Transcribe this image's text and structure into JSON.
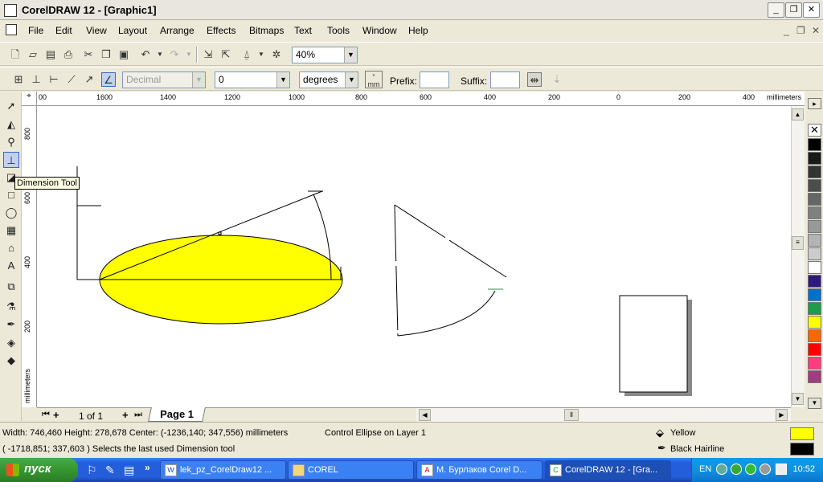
{
  "window": {
    "title": "CorelDRAW 12 - [Graphic1]"
  },
  "menu": [
    "File",
    "Edit",
    "View",
    "Layout",
    "Arrange",
    "Effects",
    "Bitmaps",
    "Text",
    "Tools",
    "Window",
    "Help"
  ],
  "toolbar": {
    "zoom": "40%"
  },
  "property_bar": {
    "style": "Decimal",
    "precision": "0",
    "units": "degrees",
    "units_button": "mm",
    "prefix_label": "Prefix:",
    "suffix_label": "Suffix:",
    "prefix_value": "",
    "suffix_value": ""
  },
  "tooltip": "Dimension Tool",
  "rulers": {
    "horizontal_ticks": [
      "00",
      "1600",
      "1400",
      "1200",
      "1000",
      "800",
      "600",
      "400",
      "200",
      "0",
      "200",
      "400"
    ],
    "vertical_ticks": [
      "800",
      "600",
      "400",
      "200"
    ],
    "unit": "millimeters"
  },
  "page_nav": {
    "count": "1 of 1",
    "tab": "Page 1"
  },
  "status": {
    "line1": "Width: 746,460  Height: 278,678  Center: (-1236,140; 347,556)  millimeters",
    "object": "Control Ellipse on Layer 1",
    "line2": "( -1718,851; 337,603 )  Selects the last used Dimension tool",
    "fill": "Yellow",
    "outline": "Black  Hairline"
  },
  "colors": {
    "fill": "#ffff00",
    "outline": "#000000",
    "palette": [
      "#000000",
      "#1a1a1a",
      "#333333",
      "#4d4d4d",
      "#666666",
      "#808080",
      "#999999",
      "#b3b3b3",
      "#cccccc",
      "#ffffff",
      "#2e1a7a",
      "#0070c8",
      "#1a9e4a",
      "#ffff00",
      "#ff6600",
      "#ff0000",
      "#ff3d7f",
      "#9e3d7f"
    ]
  },
  "taskbar": {
    "start": "пуск",
    "tasks": [
      "lek_pz_CorelDraw12 ...",
      "COREL",
      "М. Бурлаков Corel D...",
      "CorelDRAW 12 - [Gra..."
    ],
    "lang": "EN",
    "time": "10:52"
  }
}
